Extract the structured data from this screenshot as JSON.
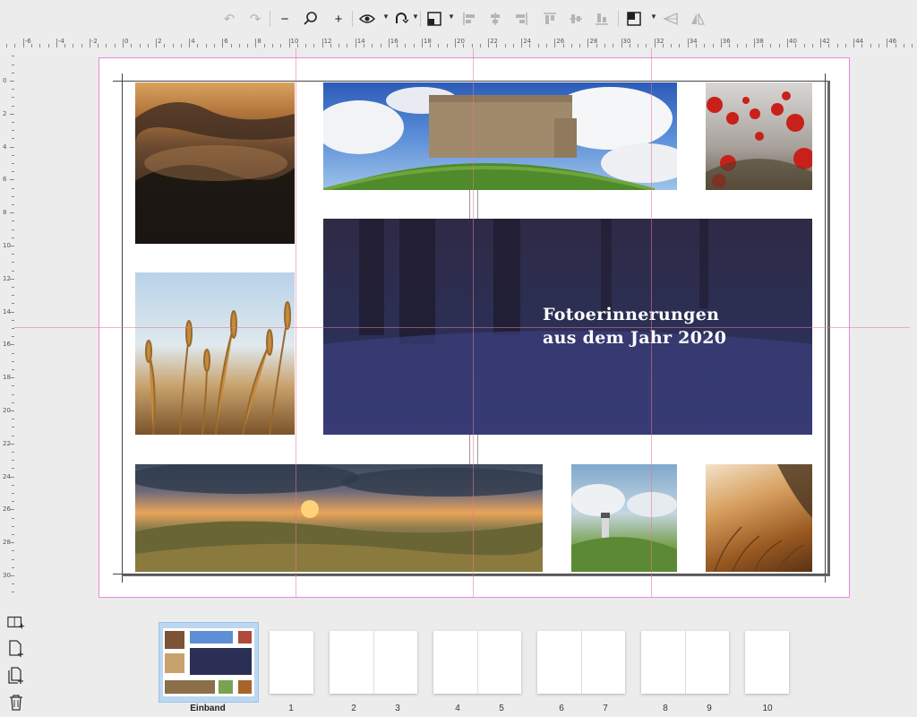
{
  "toolbar": {
    "buttons": [
      {
        "icon": "undo-icon",
        "glyph": "↶",
        "enabled": false
      },
      {
        "icon": "redo-icon",
        "glyph": "↷",
        "enabled": false
      },
      {
        "icon": "zoom-out-icon",
        "glyph": "−",
        "enabled": true
      },
      {
        "icon": "zoom-icon",
        "glyph": "⚲",
        "enabled": true
      },
      {
        "icon": "zoom-in-icon",
        "glyph": "+",
        "enabled": true
      },
      {
        "icon": "preview-eye-icon",
        "glyph": "👁",
        "enabled": true
      },
      {
        "icon": "snap-magnet-icon",
        "glyph": "⟲",
        "enabled": true
      },
      {
        "icon": "arrange-icon",
        "glyph": "◩",
        "enabled": true
      },
      {
        "icon": "align-left-icon",
        "glyph": "⊫",
        "enabled": false
      },
      {
        "icon": "align-center-icon",
        "glyph": "⊕",
        "enabled": false
      },
      {
        "icon": "align-right-icon",
        "glyph": "⊪",
        "enabled": false
      },
      {
        "icon": "align-top-icon",
        "glyph": "⊤",
        "enabled": false
      },
      {
        "icon": "align-middle-icon",
        "glyph": "⊞",
        "enabled": false
      },
      {
        "icon": "align-bottom-icon",
        "glyph": "⊥",
        "enabled": false
      },
      {
        "icon": "layer-order-icon",
        "glyph": "◩",
        "enabled": true
      },
      {
        "icon": "flip-horizontal-icon",
        "glyph": "⇌",
        "enabled": false
      },
      {
        "icon": "flip-vertical-icon",
        "glyph": "⇅",
        "enabled": false
      }
    ]
  },
  "rulers": {
    "top_labels": [
      "-6",
      "-4",
      "-2",
      "0",
      "2",
      "4",
      "6",
      "8",
      "10",
      "12",
      "14",
      "16",
      "18",
      "20",
      "22",
      "24",
      "26",
      "28",
      "30",
      "32",
      "34",
      "36",
      "38",
      "40",
      "42",
      "44",
      "46"
    ],
    "left_labels": [
      "0",
      "2",
      "4",
      "6",
      "8",
      "10",
      "12",
      "14",
      "16",
      "18",
      "20",
      "22",
      "24",
      "26",
      "28",
      "30"
    ]
  },
  "cover": {
    "title_line1": "Fotoerinnerungen",
    "title_line2": "aus dem Jahr 2020"
  },
  "pages_panel": {
    "selected_label": "Einband",
    "page_numbers": [
      "1",
      "2",
      "3",
      "4",
      "5",
      "6",
      "7",
      "8",
      "9",
      "10"
    ],
    "side_icons": [
      "add-spread-icon",
      "add-page-icon",
      "duplicate-page-icon",
      "delete-page-icon"
    ]
  },
  "colors": {
    "accent_selection": "#bcd7f0",
    "page_bleed_border": "#e38ae0",
    "guide_line": "#e6788c",
    "title_panel": "#2b2f55"
  }
}
